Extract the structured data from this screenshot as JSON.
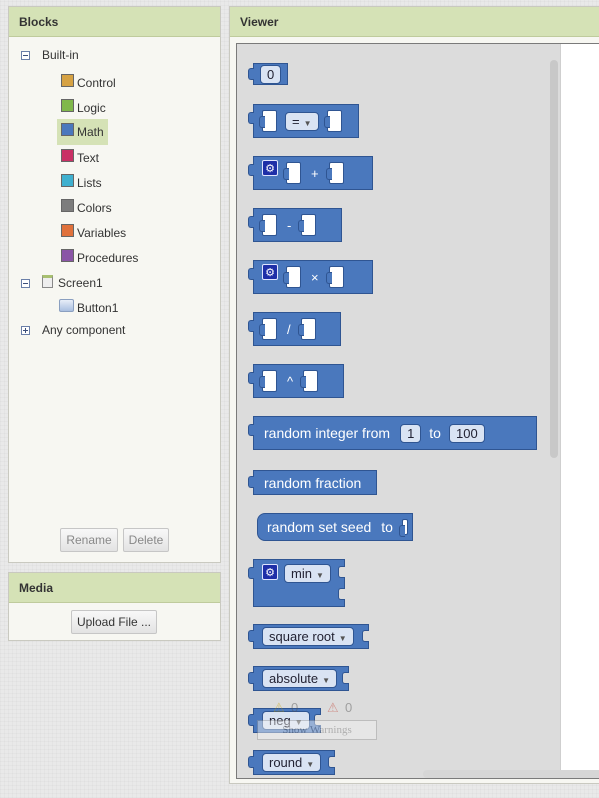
{
  "blocks_panel": {
    "title": "Blocks",
    "builtin_label": "Built-in",
    "categories": [
      {
        "label": "Control",
        "color": "#d6a243"
      },
      {
        "label": "Logic",
        "color": "#80b84b"
      },
      {
        "label": "Math",
        "color": "#4a78bd"
      },
      {
        "label": "Text",
        "color": "#c93065"
      },
      {
        "label": "Lists",
        "color": "#3fb0cf"
      },
      {
        "label": "Colors",
        "color": "#7d7d7d"
      },
      {
        "label": "Variables",
        "color": "#e0713b"
      },
      {
        "label": "Procedures",
        "color": "#8a55a6"
      }
    ],
    "selected_category": "Math",
    "screen_label": "Screen1",
    "button_label": "Button1",
    "any_component_label": "Any component",
    "rename_label": "Rename",
    "delete_label": "Delete"
  },
  "media_panel": {
    "title": "Media",
    "upload_label": "Upload File ..."
  },
  "viewer": {
    "title": "Viewer",
    "blocks": {
      "number_value": "0",
      "compare_op": "=",
      "add_op": "+",
      "subtract_op": "-",
      "multiply_op": "×",
      "divide_op": "/",
      "power_op": "^",
      "random_integer_label": "random integer from",
      "random_integer_to": "to",
      "random_integer_from_value": "1",
      "random_integer_to_value": "100",
      "random_fraction_label": "random fraction",
      "random_seed_label": "random set seed",
      "random_seed_to": "to",
      "min_label": "min",
      "square_root_label": "square root",
      "absolute_label": "absolute",
      "neg_label": "neg",
      "round_label": "round"
    },
    "warnings": {
      "warning_count": "0",
      "error_count": "0",
      "show_warnings_label": "Show Warnings"
    }
  }
}
